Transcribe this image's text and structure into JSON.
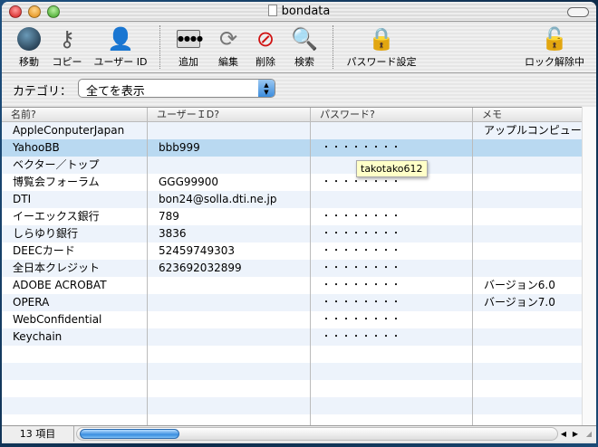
{
  "window": {
    "title": "bondata"
  },
  "toolbar": {
    "items": [
      {
        "label": "移動",
        "icon": "netscape-icon"
      },
      {
        "label": "コピー",
        "icon": "key-icon"
      },
      {
        "label": "ユーザー ID",
        "icon": "user-icon"
      },
      {
        "label": "追加",
        "icon": "add-icon"
      },
      {
        "label": "編集",
        "icon": "refresh-icon"
      },
      {
        "label": "削除",
        "icon": "delete-icon"
      },
      {
        "label": "検索",
        "icon": "search-icon"
      },
      {
        "label": "パスワード設定",
        "icon": "lock-icon"
      },
      {
        "label": "ロック解除中",
        "icon": "unlock-icon"
      }
    ]
  },
  "category": {
    "label": "カテゴリ：",
    "value": "全てを表示"
  },
  "table": {
    "headers": [
      "名前?",
      "ユーザーＩD?",
      "パスワード?",
      "メモ"
    ],
    "rows": [
      [
        "AppleConputerJapan",
        "",
        "",
        "アップルコンピュー"
      ],
      [
        "YahooBB",
        "bbb999",
        "・・・・・・・・",
        ""
      ],
      [
        "ベクター／トップ",
        "",
        "",
        ""
      ],
      [
        "博覧会フォーラム",
        "GGG99900",
        "・・・・・・・・",
        ""
      ],
      [
        "DTI",
        "bon24@solla.dti.ne.jp",
        "",
        ""
      ],
      [
        "イーエックス銀行",
        "789",
        "・・・・・・・・",
        ""
      ],
      [
        "しらゆり銀行",
        "3836",
        "・・・・・・・・",
        ""
      ],
      [
        "DEECカード",
        "52459749303",
        "・・・・・・・・",
        ""
      ],
      [
        "全日本クレジット",
        "623692032899",
        "・・・・・・・・",
        ""
      ],
      [
        "ADOBE ACROBAT",
        "",
        "・・・・・・・・",
        "バージョン6.0"
      ],
      [
        "OPERA",
        "",
        "・・・・・・・・",
        "バージョン7.0"
      ],
      [
        "WebConfidential",
        "",
        "・・・・・・・・",
        ""
      ],
      [
        "Keychain",
        "",
        "・・・・・・・・",
        ""
      ]
    ],
    "selected_row": 1
  },
  "tooltip": "takotako612",
  "status": {
    "count": "13 項目"
  }
}
